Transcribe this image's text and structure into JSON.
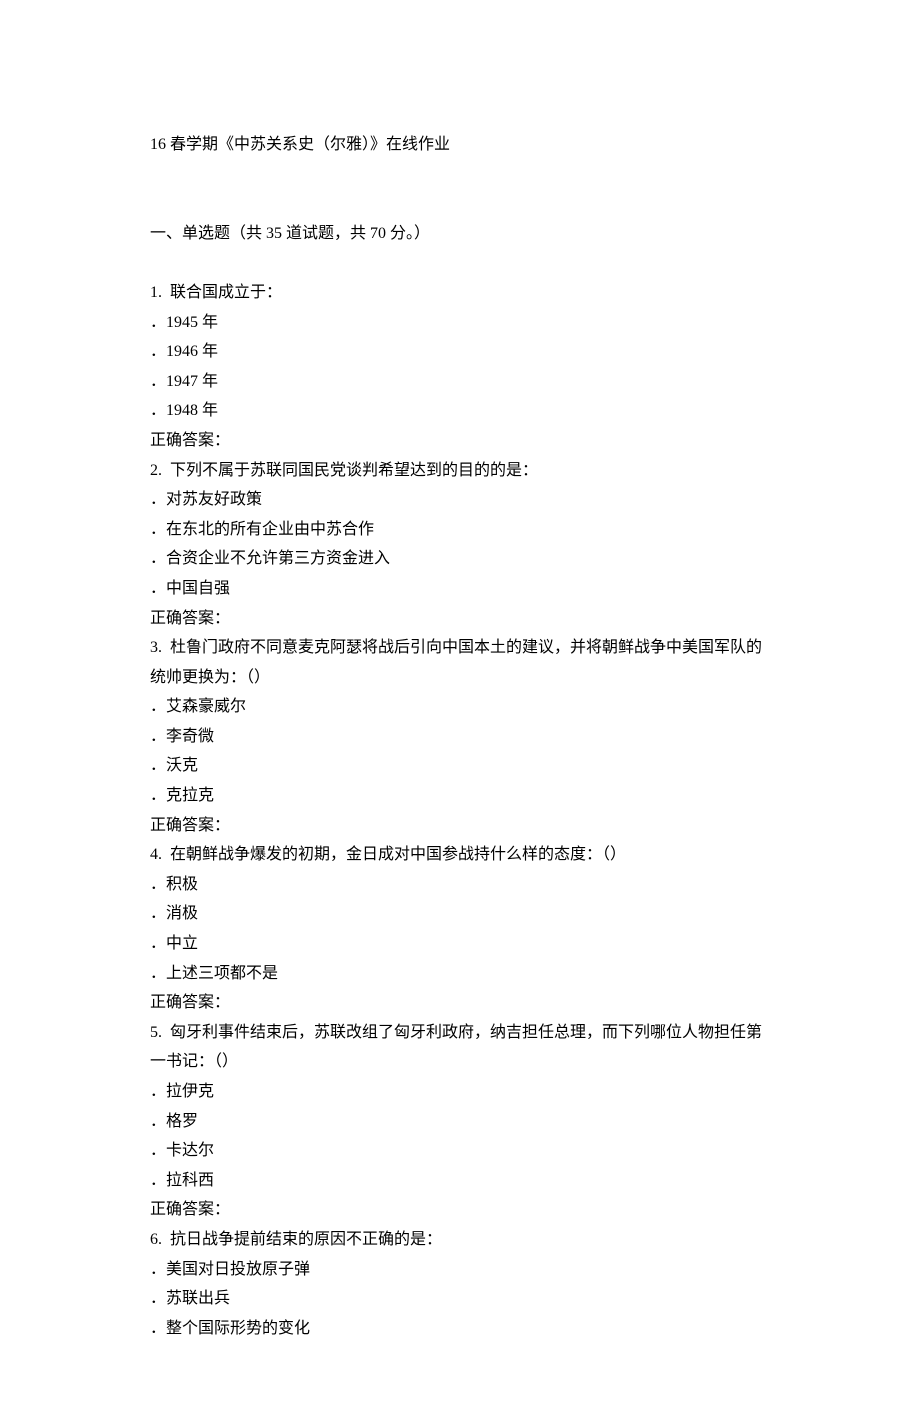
{
  "title": "16 春学期《中苏关系史（尔雅）》在线作业",
  "section_header": "一、单选题（共 35 道试题，共 70 分。）",
  "questions": [
    {
      "number": "1.",
      "stem": "联合国成立于：",
      "options": [
        "1945 年",
        "1946 年",
        "1947 年",
        "1948 年"
      ],
      "answer_label": "正确答案："
    },
    {
      "number": "2.",
      "stem": "下列不属于苏联同国民党谈判希望达到的目的的是：",
      "options": [
        "对苏友好政策",
        "在东北的所有企业由中苏合作",
        "合资企业不允许第三方资金进入",
        "中国自强"
      ],
      "answer_label": "正确答案："
    },
    {
      "number": "3.",
      "stem": "杜鲁门政府不同意麦克阿瑟将战后引向中国本土的建议，并将朝鲜战争中美国军队的统帅更换为：（）",
      "options": [
        "艾森豪威尔",
        "李奇微",
        "沃克",
        "克拉克"
      ],
      "answer_label": "正确答案："
    },
    {
      "number": "4.",
      "stem": "在朝鲜战争爆发的初期，金日成对中国参战持什么样的态度：（）",
      "options": [
        "积极",
        "消极",
        "中立",
        "上述三项都不是"
      ],
      "answer_label": "正确答案："
    },
    {
      "number": "5.",
      "stem": "匈牙利事件结束后，苏联改组了匈牙利政府，纳吉担任总理，而下列哪位人物担任第一书记：（）",
      "options": [
        "拉伊克",
        "格罗",
        "卡达尔",
        "拉科西"
      ],
      "answer_label": "正确答案："
    },
    {
      "number": "6.",
      "stem": "抗日战争提前结束的原因不正确的是：",
      "options": [
        "美国对日投放原子弹",
        "苏联出兵",
        "整个国际形势的变化"
      ],
      "answer_label": ""
    }
  ]
}
